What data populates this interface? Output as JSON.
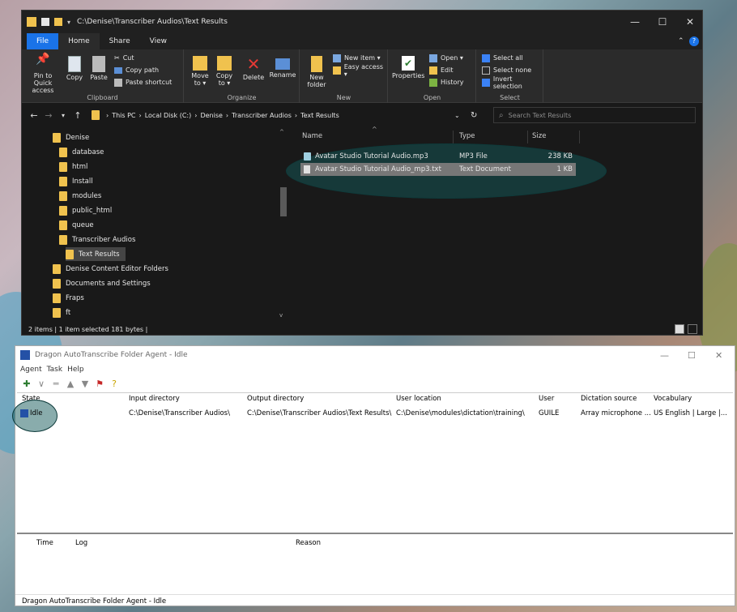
{
  "explorer": {
    "title": "C:\\Denise\\Transcriber Audios\\Text Results",
    "menu_tabs": [
      "File",
      "Home",
      "Share",
      "View"
    ],
    "ribbon": {
      "clipboard": {
        "pin_quick_access": "Pin to Quick access",
        "copy": "Copy",
        "paste": "Paste",
        "cut": "Cut",
        "copy_path": "Copy path",
        "paste_shortcut": "Paste shortcut",
        "label": "Clipboard"
      },
      "organize": {
        "move_to": "Move to ▾",
        "copy_to": "Copy to ▾",
        "delete": "Delete",
        "rename": "Rename",
        "label": "Organize"
      },
      "new": {
        "new_folder": "New folder",
        "new_item": "New item ▾",
        "easy_access": "Easy access ▾",
        "label": "New"
      },
      "open": {
        "properties": "Properties",
        "open": "Open ▾",
        "edit": "Edit",
        "history": "History",
        "label": "Open"
      },
      "select": {
        "select_all": "Select all",
        "select_none": "Select none",
        "invert_selection": "Invert selection",
        "label": "Select"
      }
    },
    "address": {
      "crumbs": [
        "This PC",
        "Local Disk (C:)",
        "Denise",
        "Transcriber Audios",
        "Text Results"
      ]
    },
    "search": {
      "placeholder": "Search Text Results"
    },
    "tree": [
      {
        "label": "Denise"
      },
      {
        "label": "database"
      },
      {
        "label": "html"
      },
      {
        "label": "Install"
      },
      {
        "label": "modules"
      },
      {
        "label": "public_html"
      },
      {
        "label": "queue"
      },
      {
        "label": "Transcriber Audios"
      },
      {
        "label": "Text Results"
      },
      {
        "label": "Denise Content Editor Folders"
      },
      {
        "label": "Documents and Settings"
      },
      {
        "label": "Fraps"
      },
      {
        "label": "ft"
      }
    ],
    "columns": {
      "name": "Name",
      "type": "Type",
      "size": "Size"
    },
    "files": [
      {
        "name": "Avatar Studio Tutorial Audio.mp3",
        "type": "MP3 File",
        "size": "238 KB"
      },
      {
        "name": "Avatar Studio Tutorial Audio_mp3.txt",
        "type": "Text Document",
        "size": "1 KB"
      }
    ],
    "status": "2 items  |  1 item selected  181 bytes  |"
  },
  "dragon": {
    "title": "Dragon AutoTranscribe Folder Agent - Idle",
    "menus": [
      "Agent",
      "Task",
      "Help"
    ],
    "columns": {
      "state": "State",
      "input": "Input directory",
      "output": "Output directory",
      "user_location": "User location",
      "user": "User",
      "dictation_source": "Dictation source",
      "vocabulary": "Vocabulary"
    },
    "row": {
      "state": "Idle",
      "input": "C:\\Denise\\Transcriber Audios\\",
      "output": "C:\\Denise\\Transcriber Audios\\Text Results\\",
      "user_location": "C:\\Denise\\modules\\dictation\\training\\",
      "user": "GUILE",
      "dictation_source": "Array microphone ...",
      "vocabulary": "US English | Large |..."
    },
    "log_columns": {
      "time": "Time",
      "log": "Log",
      "reason": "Reason"
    },
    "status": "Dragon AutoTranscribe Folder Agent - Idle"
  },
  "colors": {
    "explorer_bg": "#191919",
    "accent": "#1a73e8",
    "folder": "#f0c24e",
    "highlight": "#1a5c5c"
  }
}
